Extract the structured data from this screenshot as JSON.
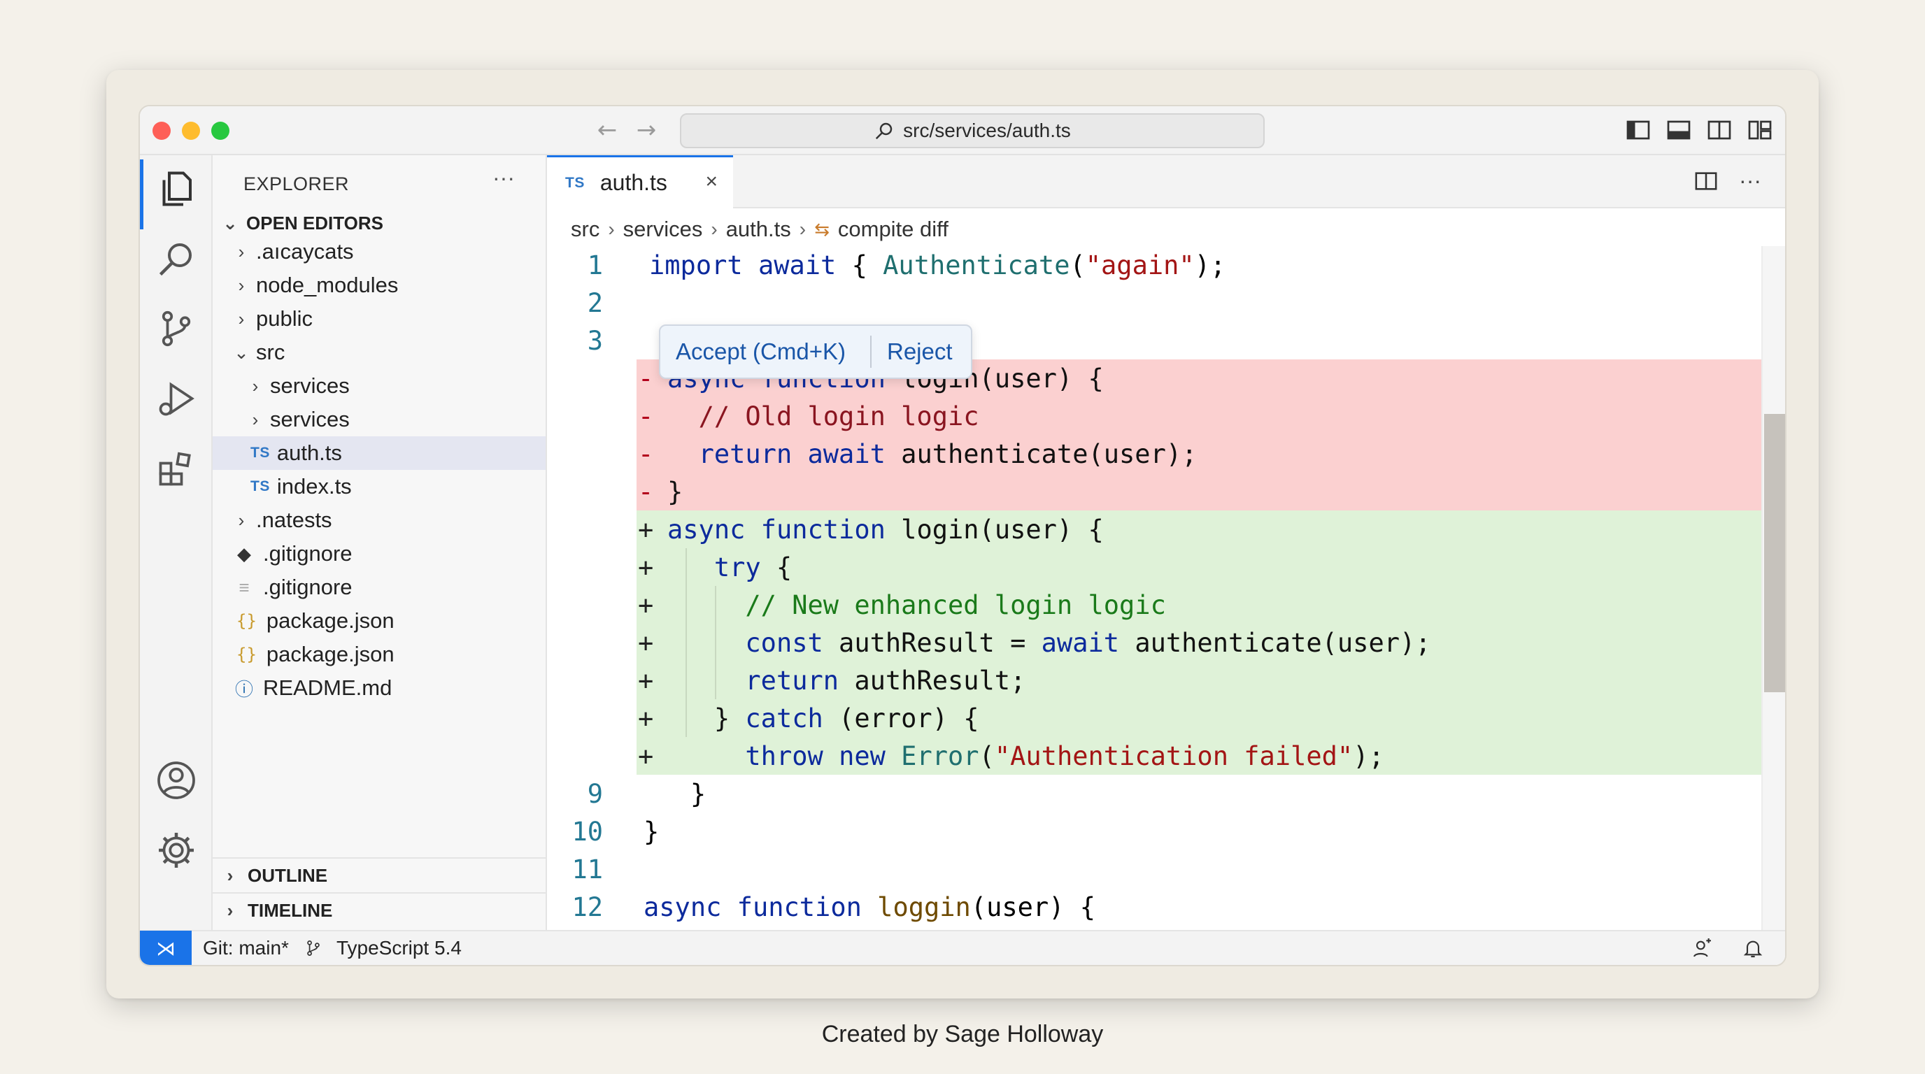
{
  "titlebar": {
    "search_text": "src/services/auth.ts",
    "layout_icons": [
      "toggle-sidebar-icon",
      "toggle-panel-icon",
      "toggle-secondary-sidebar-icon",
      "customize-layout-icon"
    ]
  },
  "sidebar": {
    "title": "EXPLORER",
    "more": "···",
    "open_editors_label": "OPEN EDITORS",
    "items": [
      {
        "label": ".aıcaycats",
        "type": "folder",
        "expanded": false
      },
      {
        "label": "node_modules",
        "type": "folder",
        "expanded": false
      },
      {
        "label": "public",
        "type": "folder",
        "expanded": false
      },
      {
        "label": "src",
        "type": "folder",
        "expanded": true
      },
      {
        "label": "services",
        "type": "folder",
        "expanded": false
      },
      {
        "label": "services",
        "type": "folder",
        "expanded": false
      },
      {
        "label": "auth.ts",
        "type": "ts",
        "badge": "TS",
        "selected": true
      },
      {
        "label": "index.ts",
        "type": "ts",
        "badge": "TS"
      },
      {
        "label": ".natests",
        "type": "folder",
        "expanded": false
      },
      {
        "label": ".gitignore",
        "type": "git"
      },
      {
        "label": ".gitignore",
        "type": "text"
      },
      {
        "label": "package.json",
        "type": "json",
        "badge": "{}"
      },
      {
        "label": "package.json",
        "type": "json",
        "badge": "{}"
      },
      {
        "label": "README.md",
        "type": "info"
      }
    ],
    "outline_label": "OUTLINE",
    "timeline_label": "TIMELINE"
  },
  "editor": {
    "tab": {
      "badge": "TS",
      "label": "auth.ts",
      "close": "×"
    },
    "breadcrumb": [
      "src",
      "services",
      "auth.ts",
      "compite diff"
    ],
    "popup": {
      "accept": "Accept (Cmd+K)",
      "reject": "Reject"
    },
    "line_numbers": {
      "l1": "1",
      "l2": "2",
      "l3": "3",
      "l9": "9",
      "l10": "10",
      "l11": "11",
      "l12": "12"
    }
  },
  "statusbar": {
    "branch": "Git: main*",
    "language": "TypeScript 5.4"
  },
  "caption": "Created by Sage Holloway",
  "colors": {
    "accent": "#1a73e8",
    "deleted_bg": "#fbd0d0",
    "added_bg": "#dff2d8"
  }
}
